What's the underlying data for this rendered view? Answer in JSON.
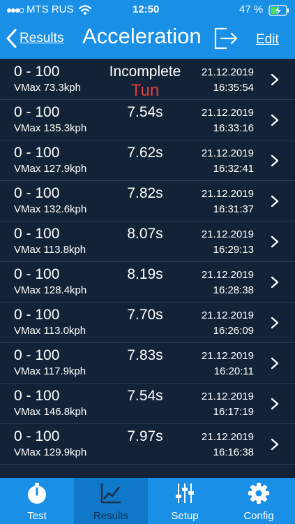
{
  "status_bar": {
    "carrier": "MTS RUS",
    "time": "12:50",
    "battery": "47 %"
  },
  "nav": {
    "back_label": "Results",
    "title": "Acceleration",
    "edit_label": "Edit",
    "export_icon": "export-icon"
  },
  "rows": [
    {
      "distance": "0 - 100",
      "vmax": "VMax 73.3kph",
      "time": "Incomplete",
      "note": "Tun",
      "date": "21.12.2019",
      "clock": "16:35:54"
    },
    {
      "distance": "0 - 100",
      "vmax": "VMax 135.3kph",
      "time": "7.54s",
      "note": "",
      "date": "21.12.2019",
      "clock": "16:33:16"
    },
    {
      "distance": "0 - 100",
      "vmax": "VMax 127.9kph",
      "time": "7.62s",
      "note": "",
      "date": "21.12.2019",
      "clock": "16:32:41"
    },
    {
      "distance": "0 - 100",
      "vmax": "VMax 132.6kph",
      "time": "7.82s",
      "note": "",
      "date": "21.12.2019",
      "clock": "16:31:37"
    },
    {
      "distance": "0 - 100",
      "vmax": "VMax 113.8kph",
      "time": "8.07s",
      "note": "",
      "date": "21.12.2019",
      "clock": "16:29:13"
    },
    {
      "distance": "0 - 100",
      "vmax": "VMax 128.4kph",
      "time": "8.19s",
      "note": "",
      "date": "21.12.2019",
      "clock": "16:28:38"
    },
    {
      "distance": "0 - 100",
      "vmax": "VMax 113.0kph",
      "time": "7.70s",
      "note": "",
      "date": "21.12.2019",
      "clock": "16:26:09"
    },
    {
      "distance": "0 - 100",
      "vmax": "VMax 117.9kph",
      "time": "7.83s",
      "note": "",
      "date": "21.12.2019",
      "clock": "16:20:11"
    },
    {
      "distance": "0 - 100",
      "vmax": "VMax 146.8kph",
      "time": "7.54s",
      "note": "",
      "date": "21.12.2019",
      "clock": "16:17:19"
    },
    {
      "distance": "0 - 100",
      "vmax": "VMax 129.9kph",
      "time": "7.97s",
      "note": "",
      "date": "21.12.2019",
      "clock": "16:16:38"
    }
  ],
  "tabs": [
    {
      "label": "Test",
      "icon": "stopwatch-icon",
      "active": false
    },
    {
      "label": "Results",
      "icon": "chart-icon",
      "active": true
    },
    {
      "label": "Setup",
      "icon": "sliders-icon",
      "active": false
    },
    {
      "label": "Config",
      "icon": "gear-icon",
      "active": false
    }
  ],
  "colors": {
    "bar": "#1a8fe6",
    "background": "#132337",
    "note": "#e33b3b"
  }
}
